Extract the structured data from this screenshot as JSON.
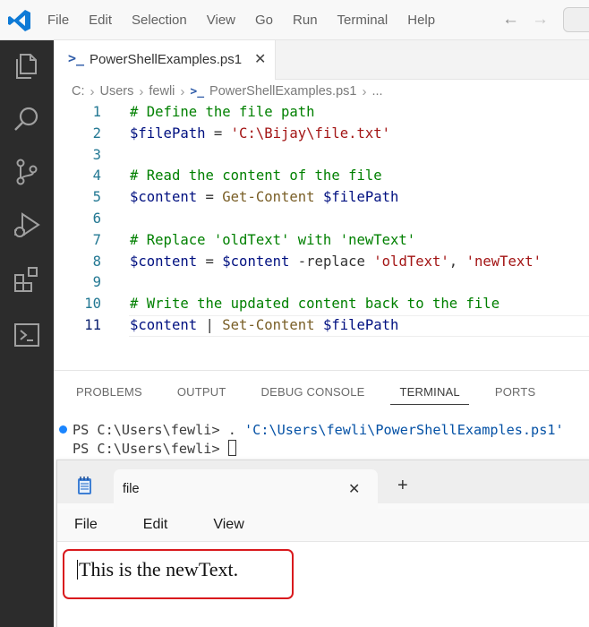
{
  "menu": [
    "File",
    "Edit",
    "Selection",
    "View",
    "Go",
    "Run",
    "Terminal",
    "Help"
  ],
  "editor": {
    "tab_label": "PowerShellExamples.ps1",
    "breadcrumb": [
      "C:",
      "Users",
      "fewli",
      "PowerShellExamples.ps1",
      "..."
    ]
  },
  "code_lines": [
    {
      "n": "1",
      "tokens": [
        {
          "t": "# Define the file path",
          "c": "c-comment"
        }
      ]
    },
    {
      "n": "2",
      "tokens": [
        {
          "t": "$filePath",
          "c": "c-var"
        },
        {
          "t": " = ",
          "c": "c-op"
        },
        {
          "t": "'C:\\Bijay\\file.txt'",
          "c": "c-str"
        }
      ]
    },
    {
      "n": "3",
      "tokens": []
    },
    {
      "n": "4",
      "tokens": [
        {
          "t": "# Read the content of the file",
          "c": "c-comment"
        }
      ]
    },
    {
      "n": "5",
      "tokens": [
        {
          "t": "$content",
          "c": "c-var"
        },
        {
          "t": " = ",
          "c": "c-op"
        },
        {
          "t": "Get-Content",
          "c": "c-cmd"
        },
        {
          "t": " ",
          "c": "c-op"
        },
        {
          "t": "$filePath",
          "c": "c-var"
        }
      ]
    },
    {
      "n": "6",
      "tokens": []
    },
    {
      "n": "7",
      "tokens": [
        {
          "t": "# Replace 'oldText' with 'newText'",
          "c": "c-comment"
        }
      ]
    },
    {
      "n": "8",
      "tokens": [
        {
          "t": "$content",
          "c": "c-var"
        },
        {
          "t": " = ",
          "c": "c-op"
        },
        {
          "t": "$content",
          "c": "c-var"
        },
        {
          "t": " -replace ",
          "c": "c-op"
        },
        {
          "t": "'oldText'",
          "c": "c-str"
        },
        {
          "t": ", ",
          "c": "c-op"
        },
        {
          "t": "'newText'",
          "c": "c-str"
        }
      ]
    },
    {
      "n": "9",
      "tokens": []
    },
    {
      "n": "10",
      "tokens": [
        {
          "t": "# Write the updated content back to the file",
          "c": "c-comment"
        }
      ]
    },
    {
      "n": "11",
      "tokens": [
        {
          "t": "$content",
          "c": "c-var"
        },
        {
          "t": " ",
          "c": "c-op"
        },
        {
          "t": "|",
          "c": "cursor"
        },
        {
          "t": " ",
          "c": "c-op"
        },
        {
          "t": "Set-Content",
          "c": "c-cmd"
        },
        {
          "t": " ",
          "c": "c-op"
        },
        {
          "t": "$filePath",
          "c": "c-var"
        }
      ]
    }
  ],
  "panel": {
    "tabs": [
      "PROBLEMS",
      "OUTPUT",
      "DEBUG CONSOLE",
      "TERMINAL",
      "PORTS"
    ],
    "active_tab": "TERMINAL",
    "term_line1_prompt": "PS C:\\Users\\fewli> . ",
    "term_line1_path": "'C:\\Users\\fewli\\PowerShellExamples.ps1'",
    "term_line2_prompt": "PS C:\\Users\\fewli> "
  },
  "notepad": {
    "tab_label": "file",
    "close_glyph": "✕",
    "new_tab_glyph": "+",
    "menu": [
      "File",
      "Edit",
      "View"
    ],
    "content": "This is the newText."
  },
  "colors": {
    "activitybar": "#2c2c2c",
    "vscode_blue": "#007acc",
    "highlight_red": "#d9191d"
  }
}
